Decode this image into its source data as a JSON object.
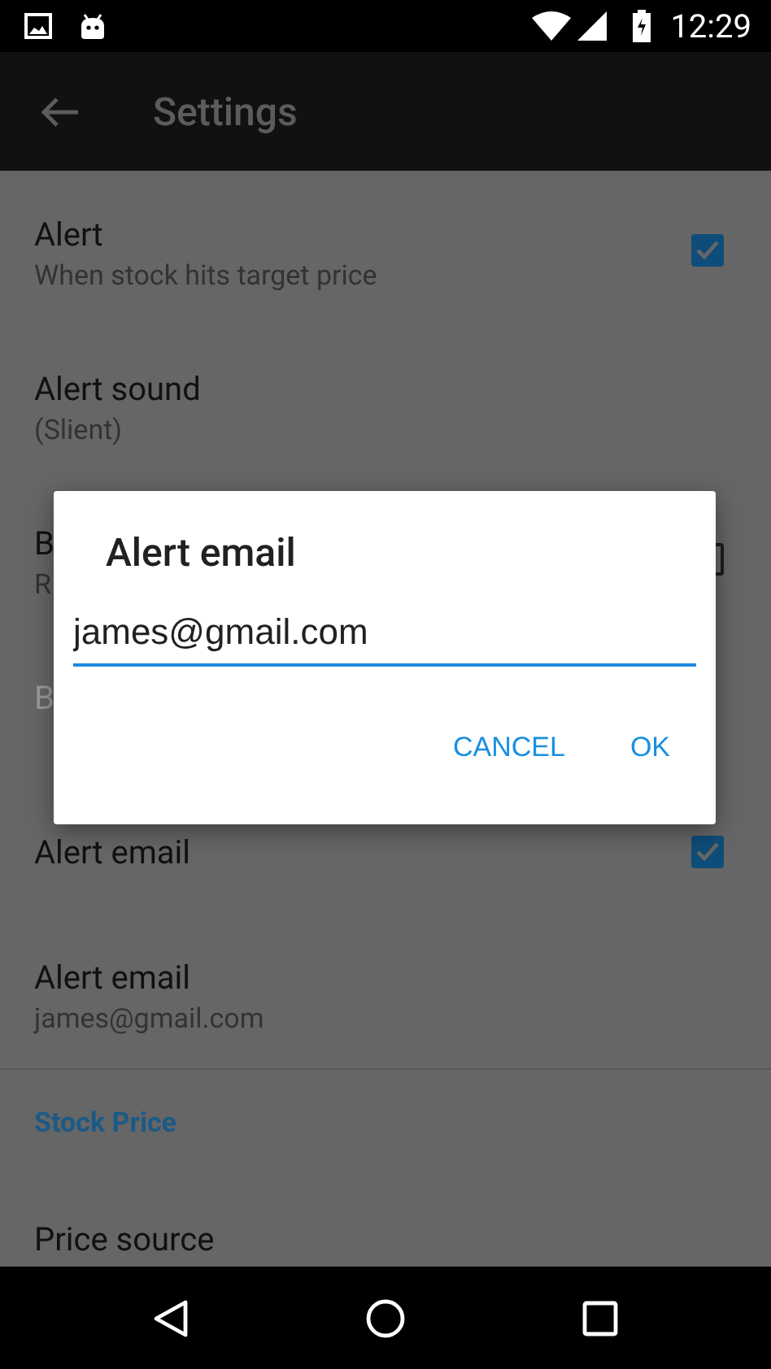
{
  "status_bar": {
    "time": "12:29"
  },
  "app_bar": {
    "title": "Settings"
  },
  "preferences": [
    {
      "kind": "checkbox",
      "title": "Alert",
      "summary": "When stock hits target price",
      "checked": true,
      "disabled": false
    },
    {
      "kind": "text",
      "title": "Alert sound",
      "summary": "(Slient)",
      "disabled": false
    },
    {
      "kind": "checkbox",
      "title": "B",
      "summary": "R",
      "checked": false,
      "disabled": false
    },
    {
      "kind": "text",
      "title": "B",
      "disabled": true
    },
    {
      "kind": "checkbox",
      "title": "Alert email",
      "checked": true,
      "disabled": false
    },
    {
      "kind": "text",
      "title": "Alert email",
      "summary": "james@gmail.com",
      "disabled": false
    },
    {
      "kind": "header",
      "title": "Stock Price"
    },
    {
      "kind": "text",
      "title": "Price source",
      "disabled": false
    }
  ],
  "dialog": {
    "title": "Alert email",
    "value": "james@gmail.com",
    "buttons": [
      "CANCEL",
      "OK"
    ]
  }
}
